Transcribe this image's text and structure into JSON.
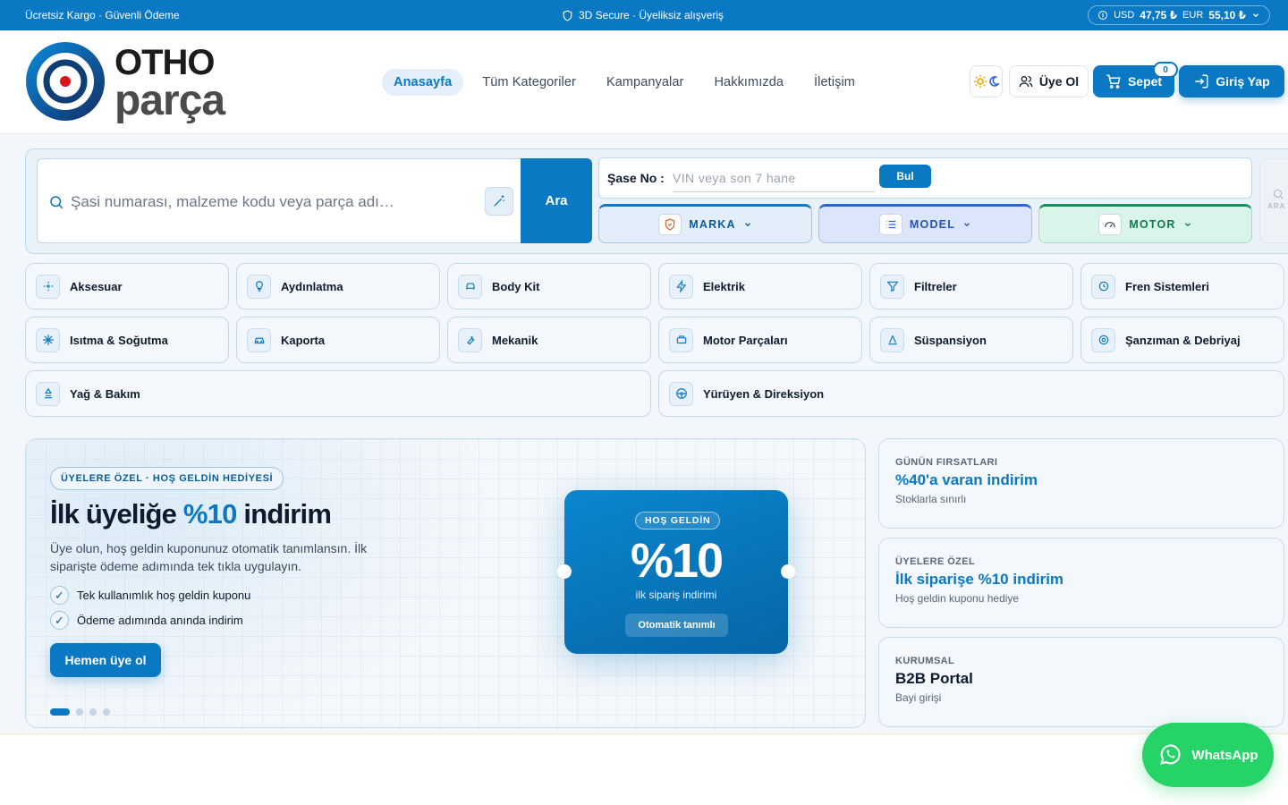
{
  "topbar": {
    "left": "Ücretsiz Kargo · Güvenli Ödeme",
    "center": "3D Secure · Üyeliksiz alışveriş",
    "usd_label": "USD",
    "usd_value": "47,75 ₺",
    "eur_label": "EUR",
    "eur_value": "55,10 ₺"
  },
  "logo": {
    "line1": "OTHO",
    "line2": "parça"
  },
  "nav": [
    "Anasayfa",
    "Tüm Kategoriler",
    "Kampanyalar",
    "Hakkımızda",
    "İletişim"
  ],
  "actions": {
    "signup": "Üye Ol",
    "cart": "Sepet",
    "cart_count": "0",
    "login": "Giriş Yap"
  },
  "search": {
    "placeholder": "Şasi numarası, malzeme kodu veya parça adı…",
    "button": "Ara",
    "vin_label": "Şase No :",
    "vin_placeholder": "VIN veya son 7 hane",
    "vin_button": "Bul",
    "selectors": [
      "MARKA",
      "MODEL",
      "MOTOR"
    ],
    "ghost": "ARA"
  },
  "categories": [
    {
      "label": "Aksesuar",
      "icon": "sparkle-icon"
    },
    {
      "label": "Aydınlatma",
      "icon": "bulb-icon"
    },
    {
      "label": "Body Kit",
      "icon": "car-front-icon"
    },
    {
      "label": "Elektrik",
      "icon": "bolt-icon"
    },
    {
      "label": "Filtreler",
      "icon": "filter-icon"
    },
    {
      "label": "Fren Sistemleri",
      "icon": "brake-icon"
    },
    {
      "label": "Isıtma & Soğutma",
      "icon": "snowflake-icon"
    },
    {
      "label": "Kaporta",
      "icon": "car-icon"
    },
    {
      "label": "Mekanik",
      "icon": "wrench-icon"
    },
    {
      "label": "Motor Parçaları",
      "icon": "engine-icon"
    },
    {
      "label": "Süspansiyon",
      "icon": "suspension-icon"
    },
    {
      "label": "Şanzıman & Debriyaj",
      "icon": "gear-icon"
    },
    {
      "label": "Yağ & Bakım",
      "icon": "oil-icon"
    },
    {
      "label": "Yürüyen & Direksiyon",
      "icon": "steering-icon"
    }
  ],
  "hero": {
    "tag": "ÜYELERE ÖZEL · HOŞ GELDİN HEDİYESİ",
    "title_pre": "İlk üyeliğe ",
    "title_hl": "%10",
    "title_post": " indirim",
    "desc": "Üye olun, hoş geldin kuponunuz otomatik tanımlansın. İlk siparişte ödeme adımında tek tıkla uygulayın.",
    "checks": [
      "Tek kullanımlık hoş geldin kuponu",
      "Ödeme adımında anında indirim"
    ],
    "cta": "Hemen üye ol",
    "coupon": {
      "tag": "HOŞ GELDİN",
      "value": "%10",
      "sub": "ilk sipariş indirimi",
      "badge": "Otomatik tanımlı"
    }
  },
  "side_cards": [
    {
      "kicker": "GÜNÜN FIRSATLARI",
      "title": "%40'a varan indirim",
      "sub": "Stoklarla sınırlı"
    },
    {
      "kicker": "ÜYELERE ÖZEL",
      "title": "İlk siparişe %10 indirim",
      "sub": "Hoş geldin kuponu hediye"
    },
    {
      "kicker": "KURUMSAL",
      "title": "B2B Portal",
      "sub": "Bayi girişi"
    }
  ],
  "whatsapp": "WhatsApp",
  "colors": {
    "brand": "#0a78c2",
    "navy": "#0f1b2d",
    "whatsapp": "#25d366"
  }
}
